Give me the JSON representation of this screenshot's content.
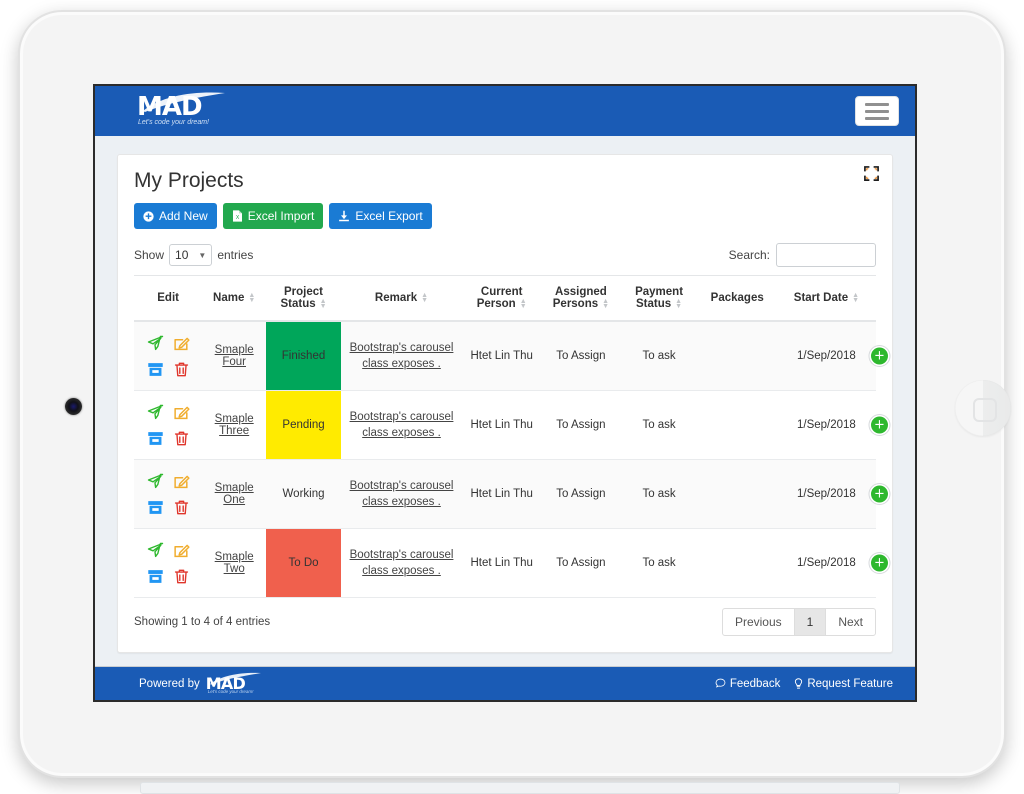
{
  "brand": {
    "logo_text": "MAD",
    "tagline": "Let's code your dream!",
    "accent_blue": "#1a5bb5"
  },
  "navbar": {
    "menu_icon": "hamburger-icon"
  },
  "card": {
    "title": "My Projects",
    "fullscreen_icon": "fullscreen-expand-icon"
  },
  "toolbar": {
    "add_new_label": "Add New",
    "excel_import_label": "Excel Import",
    "excel_export_label": "Excel Export"
  },
  "controls": {
    "show_label": "Show",
    "entries_label": "entries",
    "page_length": "10",
    "search_label": "Search:",
    "search_value": "",
    "search_placeholder": ""
  },
  "table": {
    "columns": [
      {
        "label": "Edit",
        "sortable": false
      },
      {
        "label": "Name",
        "sortable": true
      },
      {
        "label": "Project Status",
        "sortable": true
      },
      {
        "label": "Remark",
        "sortable": true
      },
      {
        "label": "Current Person",
        "sortable": true
      },
      {
        "label": "Assigned Persons",
        "sortable": true
      },
      {
        "label": "Payment Status",
        "sortable": true
      },
      {
        "label": "Packages",
        "sortable": false
      },
      {
        "label": "Start Date",
        "sortable": true
      }
    ],
    "rows": [
      {
        "name": "Smaple Four",
        "project_status": "Finished",
        "status_color": "#00a65a",
        "status_class": "st-finished",
        "remark": "Bootstrap's carousel class exposes .",
        "current_person": "Htet Lin Thu",
        "assigned_persons": "To Assign",
        "payment_status": "To ask",
        "packages": "",
        "start_date": "1/Sep/2018"
      },
      {
        "name": "Smaple Three",
        "project_status": "Pending",
        "status_color": "#ffeb00",
        "status_class": "st-pending",
        "remark": "Bootstrap's carousel class exposes .",
        "current_person": "Htet Lin Thu",
        "assigned_persons": "To Assign",
        "payment_status": "To ask",
        "packages": "",
        "start_date": "1/Sep/2018"
      },
      {
        "name": "Smaple One",
        "project_status": "Working",
        "status_color": "#ffffff",
        "status_class": "st-working",
        "remark": "Bootstrap's carousel class exposes .",
        "current_person": "Htet Lin Thu",
        "assigned_persons": "To Assign",
        "payment_status": "To ask",
        "packages": "",
        "start_date": "1/Sep/2018"
      },
      {
        "name": "Smaple Two",
        "project_status": "To Do",
        "status_color": "#f0604d",
        "status_class": "st-todo",
        "remark": "Bootstrap's carousel class exposes .",
        "current_person": "Htet Lin Thu",
        "assigned_persons": "To Assign",
        "payment_status": "To ask",
        "packages": "",
        "start_date": "1/Sep/2018"
      }
    ],
    "row_action_icons": [
      "send-plane-icon",
      "edit-pencil-icon",
      "archive-box-icon",
      "delete-trash-icon"
    ],
    "package_add_icon": "add-circle-icon"
  },
  "pagination": {
    "info": "Showing 1 to 4 of 4 entries",
    "previous_label": "Previous",
    "page_1_label": "1",
    "next_label": "Next",
    "active_page": "1"
  },
  "footer": {
    "powered_by": "Powered by",
    "feedback_label": "Feedback",
    "feedback_icon": "comment-icon",
    "request_feature_label": "Request Feature",
    "request_feature_icon": "lightbulb-icon"
  }
}
